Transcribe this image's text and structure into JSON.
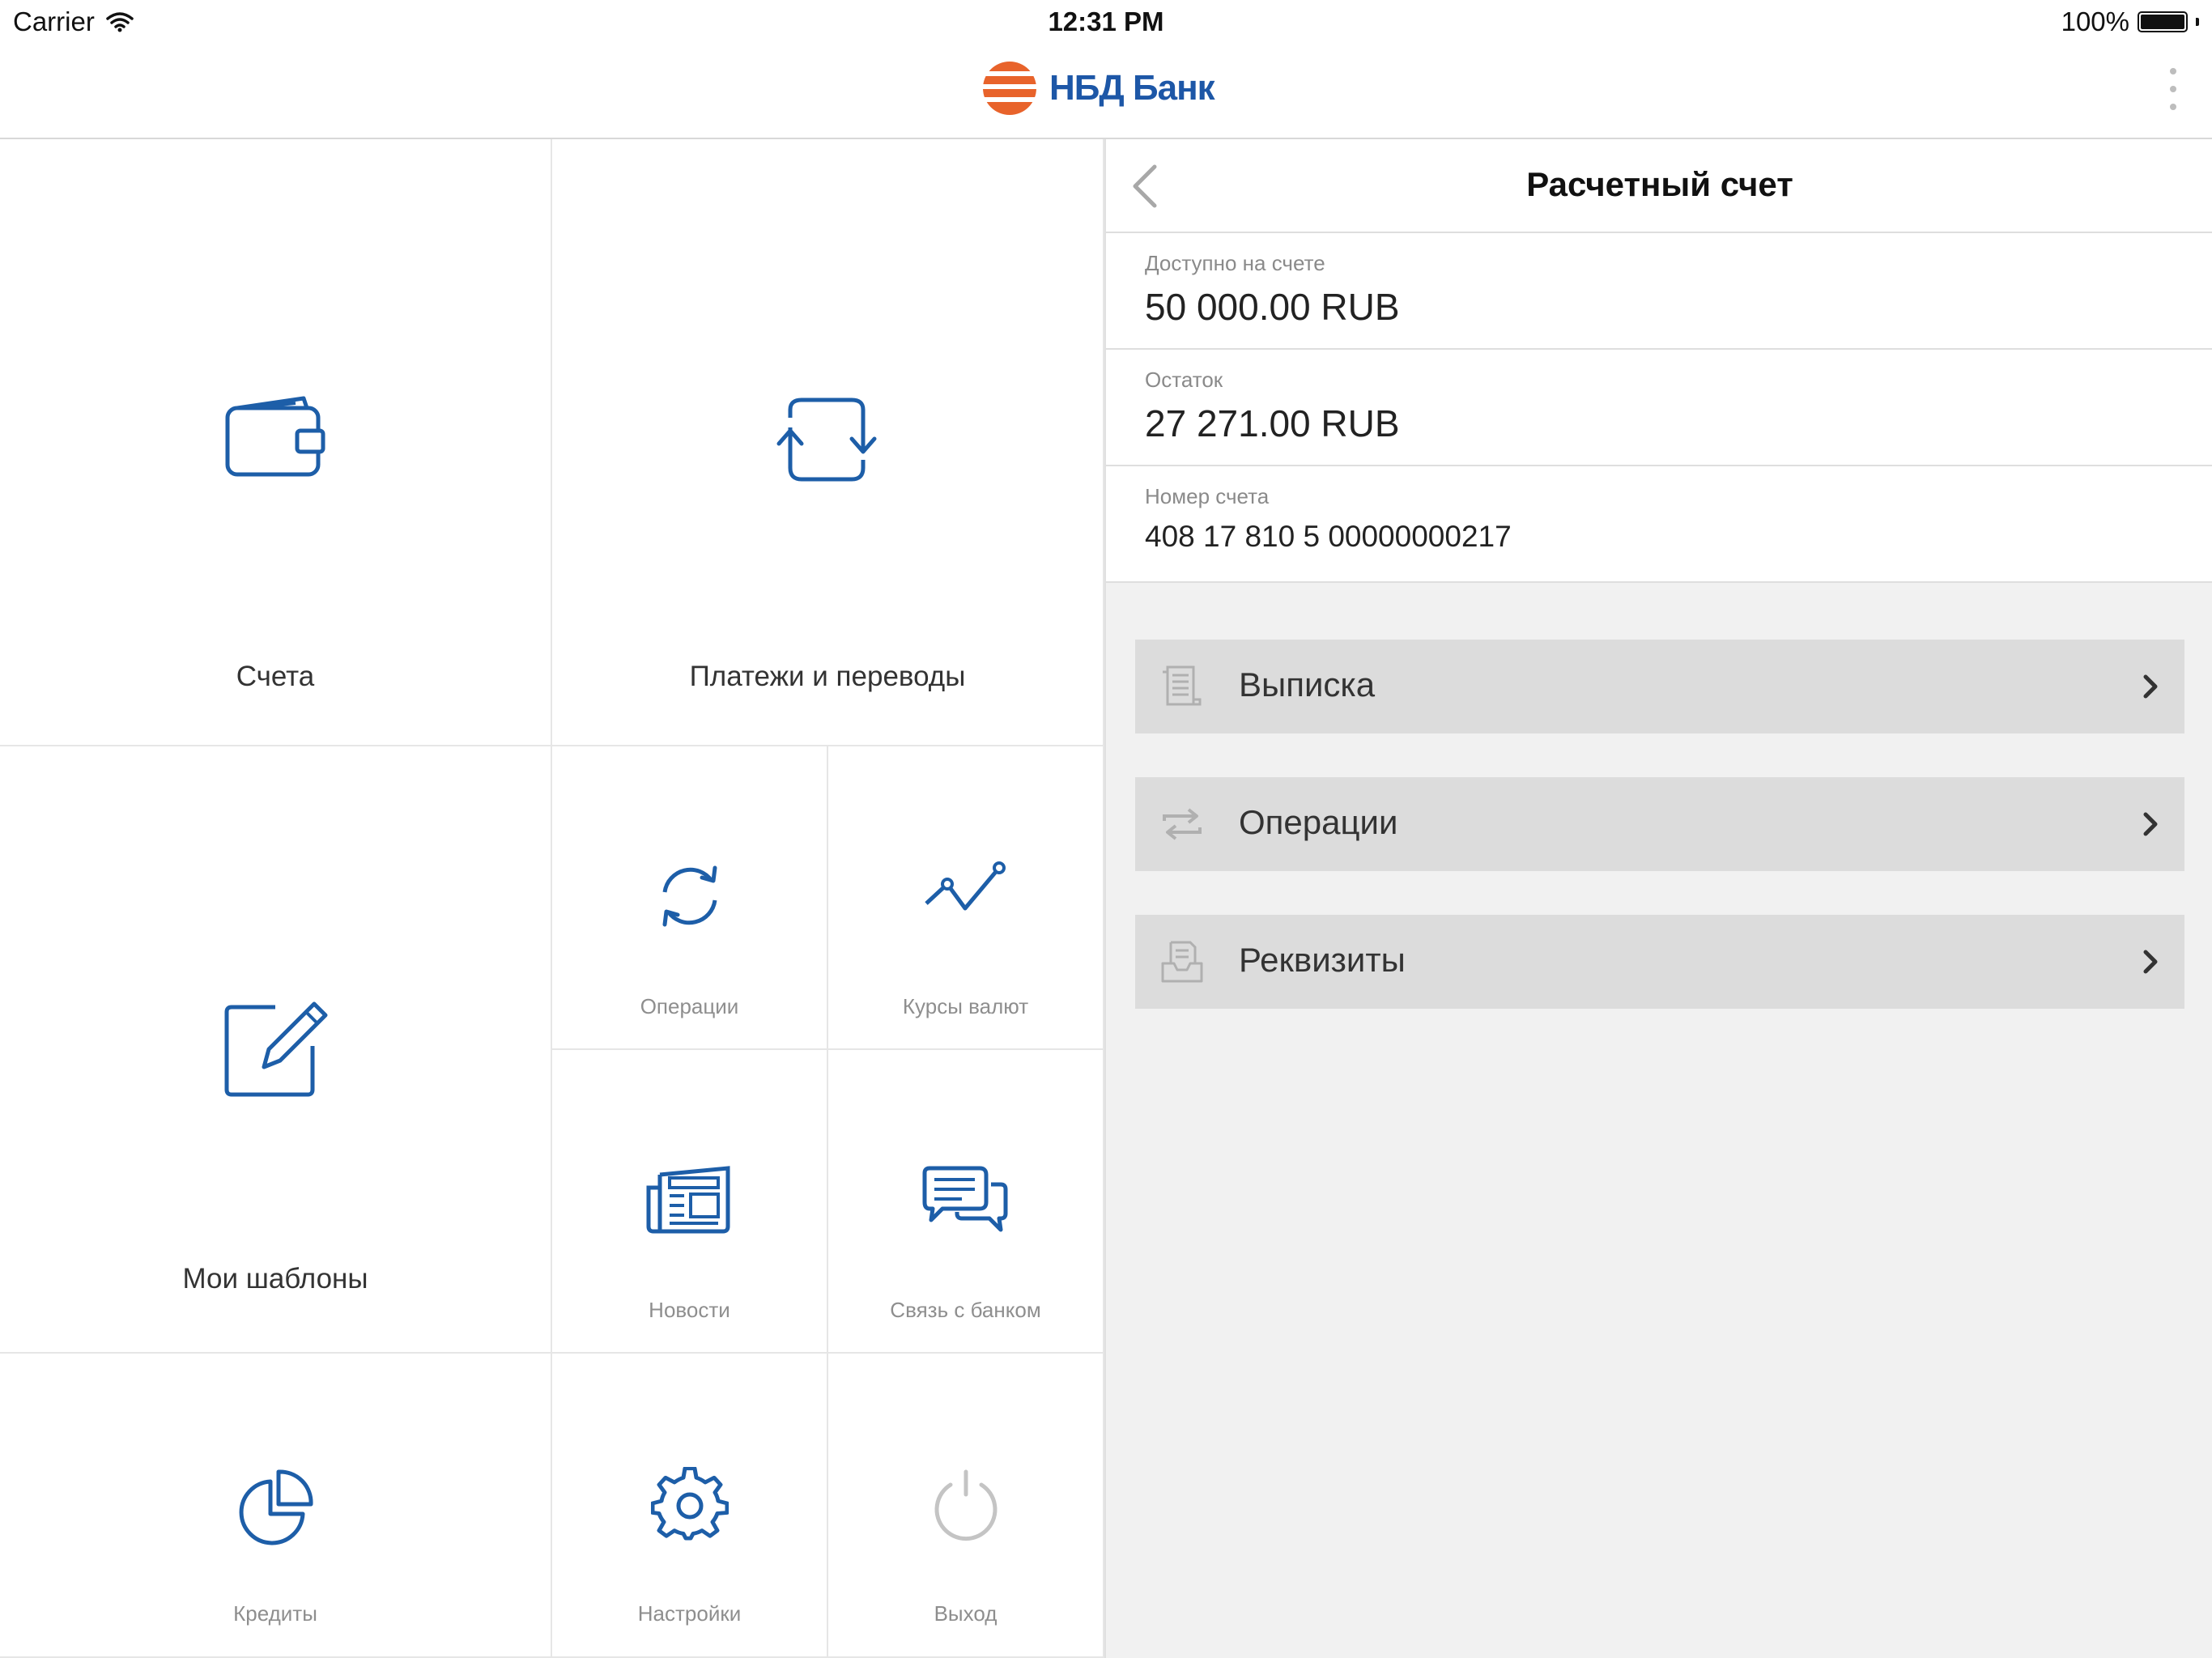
{
  "status_bar": {
    "carrier": "Carrier",
    "time": "12:31 PM",
    "battery": "100%"
  },
  "nav": {
    "logo_text": "НБД Банк",
    "logo_text_color": "#1d57a7",
    "logo_stripe_color": "#e8632b"
  },
  "menu": {
    "accounts": "Счета",
    "payments": "Платежи и переводы",
    "templates": "Мои шаблоны",
    "operations": "Операции",
    "rates": "Курсы валют",
    "news": "Новости",
    "contact": "Связь с банком",
    "credits": "Кредиты",
    "settings": "Настройки",
    "logout": "Выход"
  },
  "detail": {
    "title": "Расчетный счет",
    "available_label": "Доступно на счете",
    "available_value": "50 000.00 RUB",
    "balance_label": "Остаток",
    "balance_value": "27 271.00 RUB",
    "account_label": "Номер счета",
    "account_value": "408 17 810 5 00000000217"
  },
  "actions": {
    "statement": "Выписка",
    "operations": "Операции",
    "requisites": "Реквизиты"
  },
  "colors": {
    "icon_blue": "#1d5ea8",
    "icon_gray": "#c4c4c4",
    "accent_orange": "#e8632b"
  }
}
